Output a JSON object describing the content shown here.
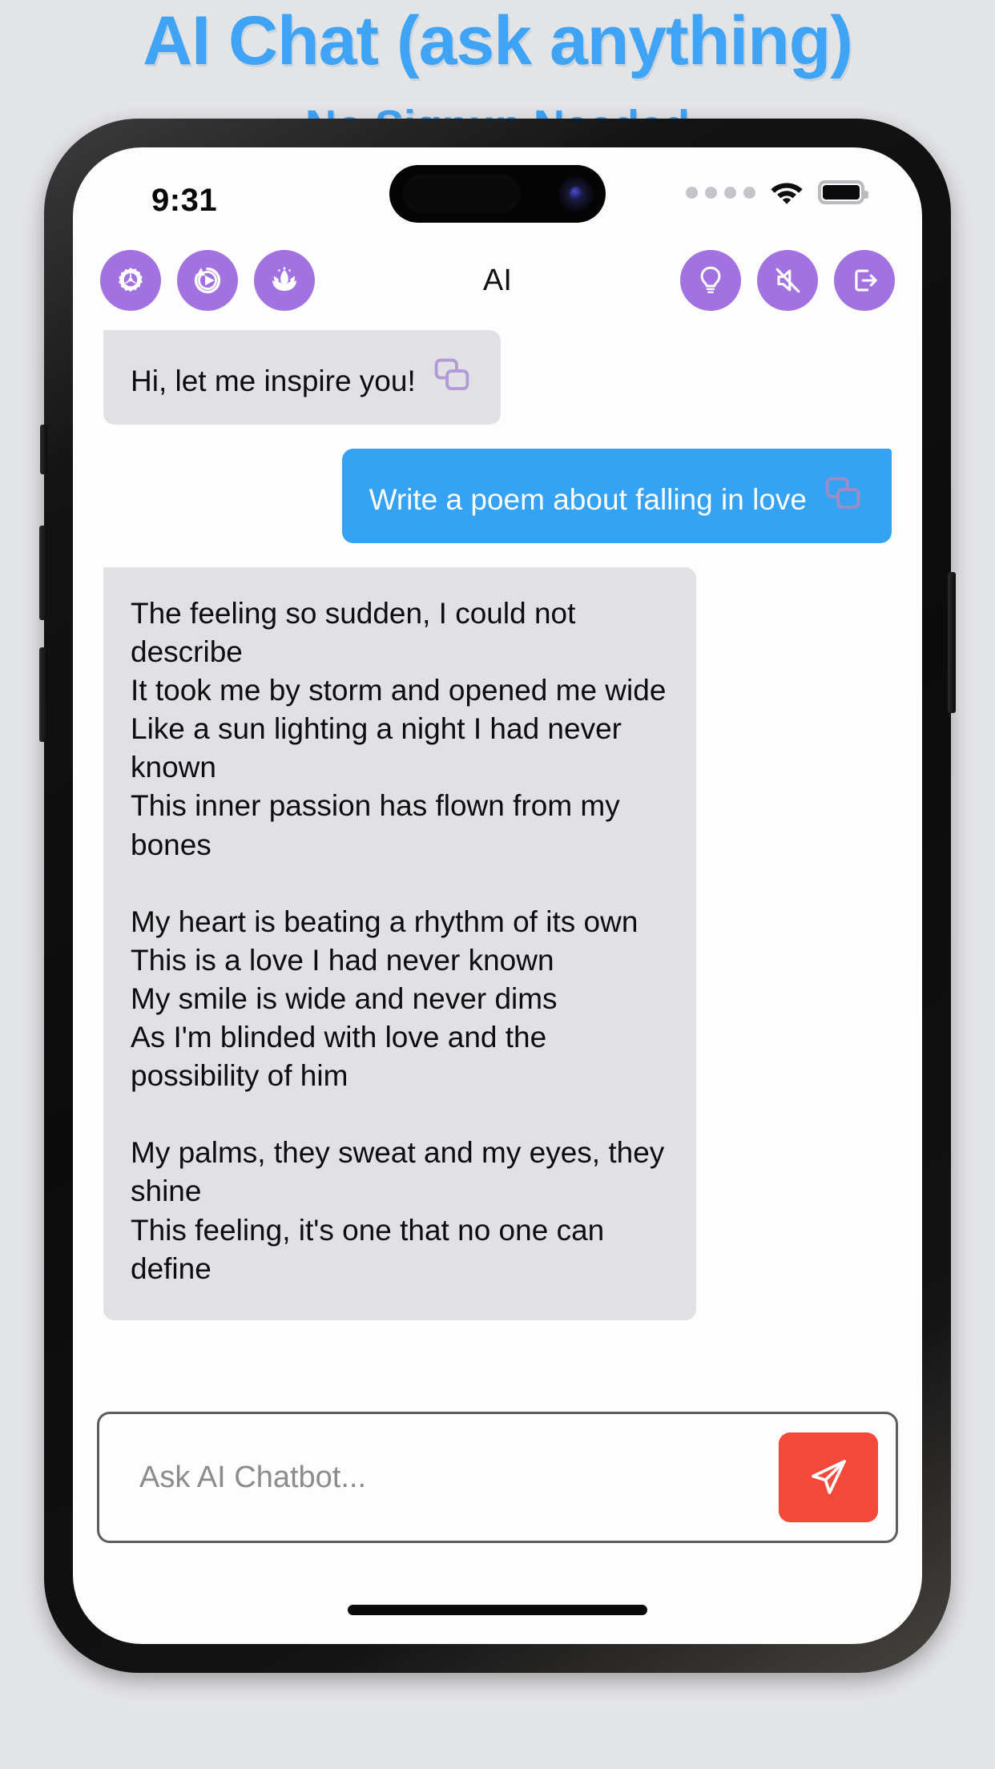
{
  "promo": {
    "title": "AI Chat (ask anything)",
    "subtitle": "No Signup Needed",
    "accent_color": "#3fa3f6"
  },
  "status_bar": {
    "time": "9:31",
    "signal_icon": "signal-dots-icon",
    "wifi_icon": "wifi-icon",
    "battery_icon": "battery-icon"
  },
  "toolbar": {
    "title": "AI",
    "left_buttons": [
      {
        "name": "settings-button",
        "icon": "gear-icon"
      },
      {
        "name": "history-button",
        "icon": "history-replay-icon"
      },
      {
        "name": "meditation-button",
        "icon": "lotus-icon"
      }
    ],
    "right_buttons": [
      {
        "name": "ideas-button",
        "icon": "lightbulb-icon"
      },
      {
        "name": "mute-button",
        "icon": "speaker-muted-icon"
      },
      {
        "name": "logout-button",
        "icon": "logout-icon"
      }
    ],
    "button_color": "#a273e0"
  },
  "chat": {
    "messages": [
      {
        "role": "bot",
        "text": "Hi, let me inspire you!",
        "copy_icon": "copy-icon",
        "bubble_color": "#e0e0e5"
      },
      {
        "role": "user",
        "text": "Write a poem about falling in love",
        "copy_icon": "copy-icon",
        "bubble_color": "#35a2f4"
      },
      {
        "role": "bot",
        "text": "The feeling so sudden, I could not describe\nIt took me by storm and opened me wide\nLike a sun lighting a night I had never known\nThis inner passion has flown from my bones\n\nMy heart is beating a rhythm of its own\nThis is a love I had never known\nMy smile is wide and never dims\nAs I'm blinded with love and the possibility of him\n\nMy palms, they sweat and my eyes, they shine\nThis feeling, it's one that no one can define",
        "copy_icon": "",
        "bubble_color": "#e0e0e5"
      }
    ]
  },
  "composer": {
    "placeholder": "Ask AI Chatbot...",
    "value": "",
    "send_icon": "send-paper-plane-icon",
    "send_color": "#f4483a"
  }
}
